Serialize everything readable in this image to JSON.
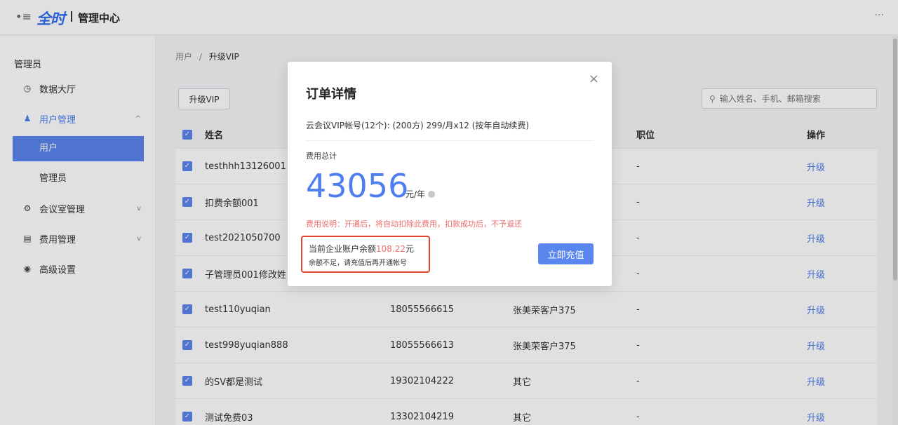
{
  "header": {
    "logo": "全时",
    "title": "管理中心",
    "more": "···"
  },
  "sidebar": {
    "section": "管理员",
    "items": [
      {
        "label": "数据大厅",
        "icon": "clock-icon"
      },
      {
        "label": "用户管理",
        "icon": "user-icon",
        "chevron": "^"
      },
      {
        "label": "会议室管理",
        "icon": "meeting-icon",
        "chevron": "v"
      },
      {
        "label": "费用管理",
        "icon": "bill-icon",
        "chevron": "v"
      },
      {
        "label": "高级设置",
        "icon": "settings-icon"
      }
    ],
    "subitems": [
      {
        "label": "用户"
      },
      {
        "label": "管理员"
      }
    ]
  },
  "breadcrumb": {
    "root": "用户",
    "sep": "/",
    "current": "升级VIP"
  },
  "toolbar": {
    "upgrade_label": "升级VIP",
    "search_placeholder": "输入姓名、手机、邮箱搜索"
  },
  "table": {
    "headers": {
      "name": "姓名",
      "phone": "",
      "dept": "",
      "position": "职位",
      "op": "操作"
    },
    "rows": [
      {
        "name": "testhhh13126001",
        "phone": "",
        "dept": "",
        "position": "-",
        "op": "升级"
      },
      {
        "name": "扣费余额001",
        "phone": "",
        "dept": "",
        "position": "-",
        "op": "升级"
      },
      {
        "name": "test2021050700",
        "phone": "",
        "dept": "",
        "position": "-",
        "op": "升级"
      },
      {
        "name": "子管理员001修改姓",
        "phone": "",
        "dept": "",
        "position": "-",
        "op": "升级"
      },
      {
        "name": "test110yuqian",
        "phone": "18055566615",
        "dept": "张美荣客户375",
        "position": "-",
        "op": "升级"
      },
      {
        "name": "test998yuqian888",
        "phone": "18055566613",
        "dept": "张美荣客户375",
        "position": "-",
        "op": "升级"
      },
      {
        "name": "的SV都是测试",
        "phone": "19302104222",
        "dept": "其它",
        "position": "-",
        "op": "升级"
      },
      {
        "name": "测试免费03",
        "phone": "13302104219",
        "dept": "其它",
        "position": "-",
        "op": "升级"
      }
    ]
  },
  "modal": {
    "close": "×",
    "title": "订单详情",
    "product": "云会议VIP帐号(12个): (200方) 299/月x12 (按年自动续费)",
    "fee_label": "费用总计",
    "amount": "43056",
    "unit": "元/年",
    "note": "费用说明：开通后，将自动扣除此费用，扣款成功后，不予退还",
    "balance_prefix": "当前企业账户余额",
    "balance_amount": "108.22",
    "balance_suffix": "元",
    "insufficient": "余额不足，请充值后再开通帐号",
    "recharge_label": "立即充值"
  },
  "colors": {
    "accent": "#5a86ee",
    "link": "#4e7ef0",
    "warning": "#ee6d6d",
    "highlight_border": "#e0452f"
  }
}
